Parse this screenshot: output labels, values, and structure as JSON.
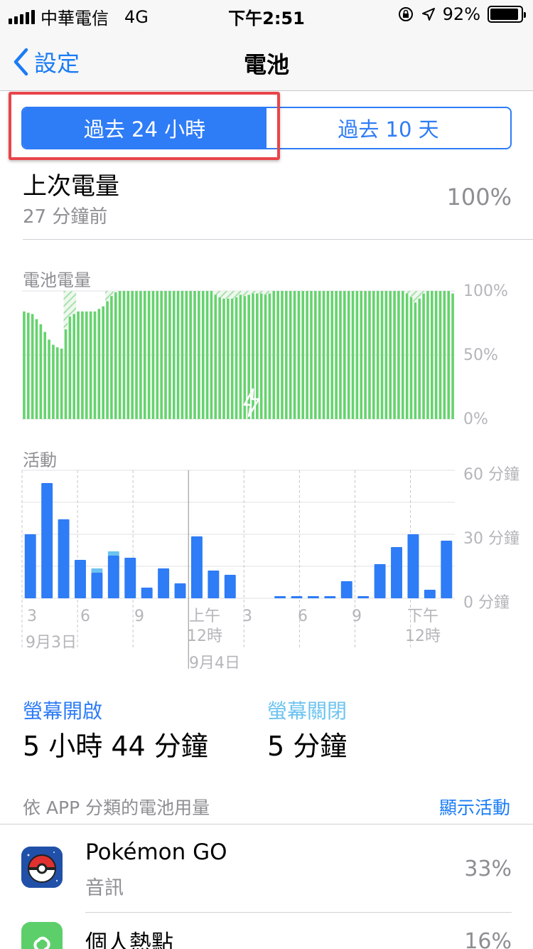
{
  "status_bar": {
    "carrier": "中華電信",
    "network": "4G",
    "time": "下午2:51",
    "battery_text": "92%",
    "battery_level": 0.92,
    "icons": [
      "signal-icon",
      "orientation-lock-icon",
      "location-arrow-icon",
      "battery-icon"
    ]
  },
  "nav": {
    "back_label": "設定",
    "title": "電池"
  },
  "segments": {
    "items": [
      "過去 24 小時",
      "過去 10 天"
    ],
    "selected_index": 0
  },
  "last_charge": {
    "title": "上次電量",
    "subtitle": "27 分鐘前",
    "value": "100%"
  },
  "battery_chart_label": "電池電量",
  "activity_chart_label": "活動",
  "screen": {
    "on_label": "螢幕開啟",
    "on_value": "5 小時 44 分鐘",
    "off_label": "螢幕關閉",
    "off_value": "5 分鐘"
  },
  "usage_section": {
    "header": "依 APP 分類的電池用量",
    "action": "顯示活動"
  },
  "apps": [
    {
      "name": "Pokémon GO",
      "subtitle": "音訊",
      "percent": "33%",
      "icon": "pokeball-icon"
    },
    {
      "name": "個人熱點",
      "subtitle": "",
      "percent": "16%",
      "icon": "hotspot-icon"
    }
  ],
  "colors": {
    "accent": "#2e7cf6",
    "link": "#1a7cf5",
    "battery_green": "#66d36e",
    "screen_on": "#2e7cf6",
    "screen_off": "#6cc3f0",
    "annotation_red": "#e8454a"
  },
  "chart_data": [
    {
      "type": "bar",
      "title": "電池電量",
      "y_ticks": [
        "100%",
        "50%",
        "0%"
      ],
      "ylim": [
        0,
        100
      ],
      "charging": true,
      "values": [
        84,
        83,
        82,
        78,
        74,
        68,
        62,
        58,
        56,
        55,
        70,
        80,
        82,
        84,
        84,
        84,
        84,
        84,
        86,
        88,
        92,
        96,
        99,
        100,
        100,
        100,
        100,
        100,
        100,
        100,
        100,
        100,
        100,
        100,
        100,
        100,
        100,
        100,
        100,
        100,
        100,
        100,
        100,
        100,
        100,
        100,
        97,
        95,
        94,
        94,
        94,
        95,
        97,
        96,
        97,
        98,
        98,
        98,
        97,
        98,
        100,
        100,
        100,
        100,
        100,
        100,
        100,
        100,
        100,
        100,
        100,
        100,
        100,
        100,
        100,
        100,
        100,
        100,
        100,
        100,
        100,
        100,
        100,
        100,
        100,
        100,
        100,
        100,
        100,
        100,
        100,
        100,
        98,
        95,
        91,
        94,
        98,
        100,
        100,
        100,
        100,
        100,
        100,
        98
      ],
      "hatched_segments": [
        [
          10,
          13
        ],
        [
          20,
          22
        ],
        [
          46,
          60
        ],
        [
          92,
          97
        ]
      ]
    },
    {
      "type": "bar",
      "title": "活動",
      "y_ticks": [
        "60 分鐘",
        "30 分鐘",
        "0 分鐘"
      ],
      "ylim": [
        0,
        60
      ],
      "x_tick_labels": [
        "3",
        "6",
        "9",
        "上午\n12時",
        "3",
        "6",
        "9",
        "下午\n12時"
      ],
      "date_labels": [
        "9月3日",
        "9月4日"
      ],
      "series": [
        {
          "name": "螢幕開啟",
          "values": [
            30,
            54,
            37,
            18,
            12,
            20,
            19,
            5,
            14,
            7,
            29,
            13,
            11,
            0,
            0,
            1,
            1,
            1,
            1,
            8,
            1,
            16,
            24,
            30,
            4,
            27
          ]
        },
        {
          "name": "螢幕關閉",
          "values": [
            0,
            0,
            0,
            0,
            2,
            2,
            0,
            0,
            0,
            0,
            0,
            0,
            0,
            0,
            0,
            0,
            0,
            0,
            0,
            0,
            0,
            0,
            0,
            0,
            0,
            0
          ]
        }
      ]
    }
  ]
}
